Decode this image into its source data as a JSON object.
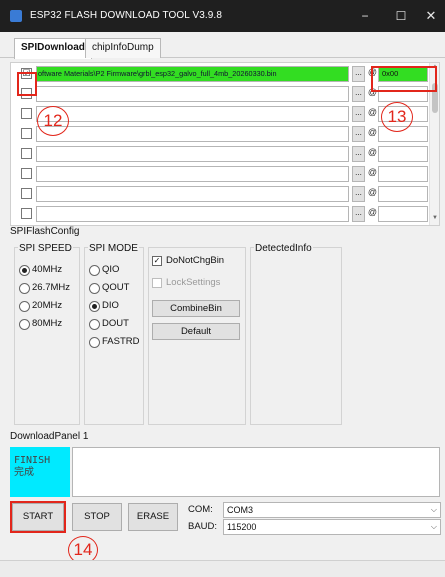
{
  "window": {
    "title": "ESP32 FLASH DOWNLOAD TOOL V3.9.8",
    "controls": {
      "minimize": "−",
      "maximize": "☐",
      "close": "✕"
    }
  },
  "tabs": [
    {
      "label": "SPIDownload",
      "active": true
    },
    {
      "label": "chipInfoDump",
      "active": false
    }
  ],
  "file_rows": [
    {
      "checked": true,
      "path": "oftware Materials\\P2 Firmware\\grbl_esp32_galvo_full_4mb_20260330.bin",
      "address": "0x00",
      "highlighted": true
    },
    {
      "checked": false,
      "path": "",
      "address": ""
    },
    {
      "checked": false,
      "path": "",
      "address": ""
    },
    {
      "checked": false,
      "path": "",
      "address": ""
    },
    {
      "checked": false,
      "path": "",
      "address": ""
    },
    {
      "checked": false,
      "path": "",
      "address": ""
    },
    {
      "checked": false,
      "path": "",
      "address": ""
    },
    {
      "checked": false,
      "path": "",
      "address": ""
    }
  ],
  "row_controls": {
    "browse_label": "...",
    "at_label": "@",
    "check_mark": "☑"
  },
  "annotations": {
    "step_12": "12",
    "step_13": "13",
    "step_14": "14"
  },
  "spi_flash_config": {
    "title": "SPIFlashConfig",
    "spi_speed": {
      "label": "SPI SPEED",
      "options": [
        "40MHz",
        "26.7MHz",
        "20MHz",
        "80MHz"
      ],
      "selected": "40MHz"
    },
    "spi_mode": {
      "label": "SPI MODE",
      "options": [
        "QIO",
        "QOUT",
        "DIO",
        "DOUT",
        "FASTRD"
      ],
      "selected": "DIO"
    },
    "do_not_chg_bin": {
      "label": "DoNotChgBin",
      "checked": true
    },
    "lock_settings": {
      "label": "LockSettings",
      "checked": false,
      "disabled": true
    },
    "combine_bin_label": "CombineBin",
    "default_label": "Default",
    "detected_info_label": "DetectedInfo"
  },
  "download_panel": {
    "title": "DownloadPanel 1",
    "status_en": "FINISH",
    "status_zh": "完成",
    "status_color": "#00eaff"
  },
  "actions": {
    "start": "START",
    "stop": "STOP",
    "erase": "ERASE"
  },
  "com": {
    "label": "COM:",
    "value": "COM3"
  },
  "baud": {
    "label": "BAUD:",
    "value": "115200"
  },
  "colors": {
    "highlight_green": "#33dd22",
    "annotation_red": "#e2261b",
    "finish_cyan": "#00eaff"
  }
}
